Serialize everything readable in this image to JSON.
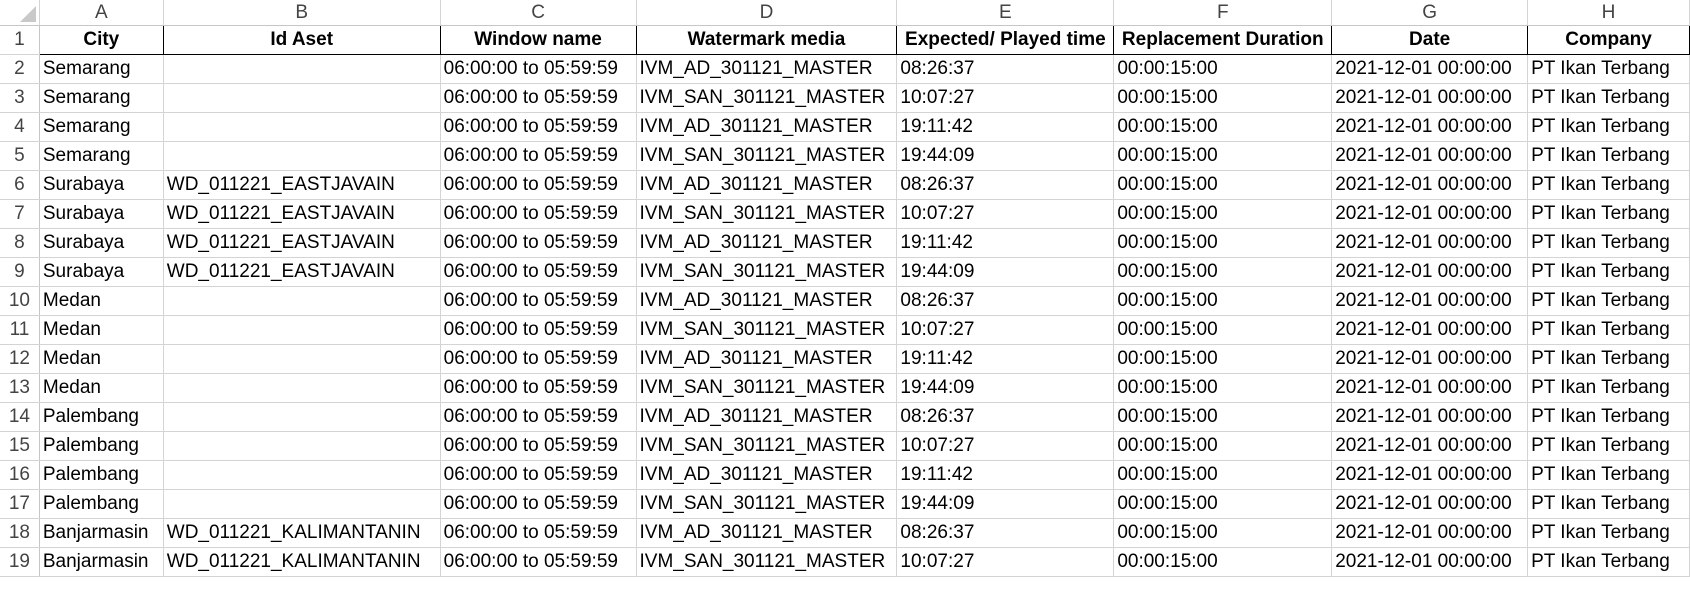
{
  "column_letters": [
    "A",
    "B",
    "C",
    "D",
    "E",
    "F",
    "G",
    "H"
  ],
  "header": [
    "City",
    "Id Aset",
    "Window name",
    "Watermark media",
    "Expected/ Played time",
    "Replacement Duration",
    "Date",
    "Company"
  ],
  "rows": [
    {
      "n": "2",
      "city": "Semarang",
      "id": "",
      "window": "06:00:00 to 05:59:59",
      "media": "IVM_AD_301121_MASTER",
      "time": "08:26:37",
      "dur": "00:00:15:00",
      "date": "2021-12-01 00:00:00",
      "company": "PT Ikan Terbang"
    },
    {
      "n": "3",
      "city": "Semarang",
      "id": "",
      "window": "06:00:00 to 05:59:59",
      "media": "IVM_SAN_301121_MASTER",
      "time": "10:07:27",
      "dur": "00:00:15:00",
      "date": "2021-12-01 00:00:00",
      "company": "PT Ikan Terbang"
    },
    {
      "n": "4",
      "city": "Semarang",
      "id": "",
      "window": "06:00:00 to 05:59:59",
      "media": "IVM_AD_301121_MASTER",
      "time": "19:11:42",
      "dur": "00:00:15:00",
      "date": "2021-12-01 00:00:00",
      "company": "PT Ikan Terbang"
    },
    {
      "n": "5",
      "city": "Semarang",
      "id": "",
      "window": "06:00:00 to 05:59:59",
      "media": "IVM_SAN_301121_MASTER",
      "time": "19:44:09",
      "dur": "00:00:15:00",
      "date": "2021-12-01 00:00:00",
      "company": "PT Ikan Terbang"
    },
    {
      "n": "6",
      "city": "Surabaya",
      "id": "WD_011221_EASTJAVAIN",
      "window": "06:00:00 to 05:59:59",
      "media": "IVM_AD_301121_MASTER",
      "time": "08:26:37",
      "dur": "00:00:15:00",
      "date": "2021-12-01 00:00:00",
      "company": "PT Ikan Terbang"
    },
    {
      "n": "7",
      "city": "Surabaya",
      "id": "WD_011221_EASTJAVAIN",
      "window": "06:00:00 to 05:59:59",
      "media": "IVM_SAN_301121_MASTER",
      "time": "10:07:27",
      "dur": "00:00:15:00",
      "date": "2021-12-01 00:00:00",
      "company": "PT Ikan Terbang"
    },
    {
      "n": "8",
      "city": "Surabaya",
      "id": "WD_011221_EASTJAVAIN",
      "window": "06:00:00 to 05:59:59",
      "media": "IVM_AD_301121_MASTER",
      "time": "19:11:42",
      "dur": "00:00:15:00",
      "date": "2021-12-01 00:00:00",
      "company": "PT Ikan Terbang"
    },
    {
      "n": "9",
      "city": "Surabaya",
      "id": "WD_011221_EASTJAVAIN",
      "window": "06:00:00 to 05:59:59",
      "media": "IVM_SAN_301121_MASTER",
      "time": "19:44:09",
      "dur": "00:00:15:00",
      "date": "2021-12-01 00:00:00",
      "company": "PT Ikan Terbang"
    },
    {
      "n": "10",
      "city": "Medan",
      "id": "",
      "window": "06:00:00 to 05:59:59",
      "media": "IVM_AD_301121_MASTER",
      "time": "08:26:37",
      "dur": "00:00:15:00",
      "date": "2021-12-01 00:00:00",
      "company": "PT Ikan Terbang"
    },
    {
      "n": "11",
      "city": "Medan",
      "id": "",
      "window": "06:00:00 to 05:59:59",
      "media": "IVM_SAN_301121_MASTER",
      "time": "10:07:27",
      "dur": "00:00:15:00",
      "date": "2021-12-01 00:00:00",
      "company": "PT Ikan Terbang"
    },
    {
      "n": "12",
      "city": "Medan",
      "id": "",
      "window": "06:00:00 to 05:59:59",
      "media": "IVM_AD_301121_MASTER",
      "time": "19:11:42",
      "dur": "00:00:15:00",
      "date": "2021-12-01 00:00:00",
      "company": "PT Ikan Terbang"
    },
    {
      "n": "13",
      "city": "Medan",
      "id": "",
      "window": "06:00:00 to 05:59:59",
      "media": "IVM_SAN_301121_MASTER",
      "time": "19:44:09",
      "dur": "00:00:15:00",
      "date": "2021-12-01 00:00:00",
      "company": "PT Ikan Terbang"
    },
    {
      "n": "14",
      "city": "Palembang",
      "id": "",
      "window": "06:00:00 to 05:59:59",
      "media": "IVM_AD_301121_MASTER",
      "time": "08:26:37",
      "dur": "00:00:15:00",
      "date": "2021-12-01 00:00:00",
      "company": "PT Ikan Terbang"
    },
    {
      "n": "15",
      "city": "Palembang",
      "id": "",
      "window": "06:00:00 to 05:59:59",
      "media": "IVM_SAN_301121_MASTER",
      "time": "10:07:27",
      "dur": "00:00:15:00",
      "date": "2021-12-01 00:00:00",
      "company": "PT Ikan Terbang"
    },
    {
      "n": "16",
      "city": "Palembang",
      "id": "",
      "window": "06:00:00 to 05:59:59",
      "media": "IVM_AD_301121_MASTER",
      "time": "19:11:42",
      "dur": "00:00:15:00",
      "date": "2021-12-01 00:00:00",
      "company": "PT Ikan Terbang"
    },
    {
      "n": "17",
      "city": "Palembang",
      "id": "",
      "window": "06:00:00 to 05:59:59",
      "media": "IVM_SAN_301121_MASTER",
      "time": "19:44:09",
      "dur": "00:00:15:00",
      "date": "2021-12-01 00:00:00",
      "company": "PT Ikan Terbang"
    },
    {
      "n": "18",
      "city": "Banjarmasin",
      "id": "WD_011221_KALIMANTANIN",
      "window": "06:00:00 to 05:59:59",
      "media": "IVM_AD_301121_MASTER",
      "time": "08:26:37",
      "dur": "00:00:15:00",
      "date": "2021-12-01 00:00:00",
      "company": "PT Ikan Terbang"
    },
    {
      "n": "19",
      "city": "Banjarmasin",
      "id": "WD_011221_KALIMANTANIN",
      "window": "06:00:00 to 05:59:59",
      "media": "IVM_SAN_301121_MASTER",
      "time": "10:07:27",
      "dur": "00:00:15:00",
      "date": "2021-12-01 00:00:00",
      "company": "PT Ikan Terbang"
    }
  ]
}
